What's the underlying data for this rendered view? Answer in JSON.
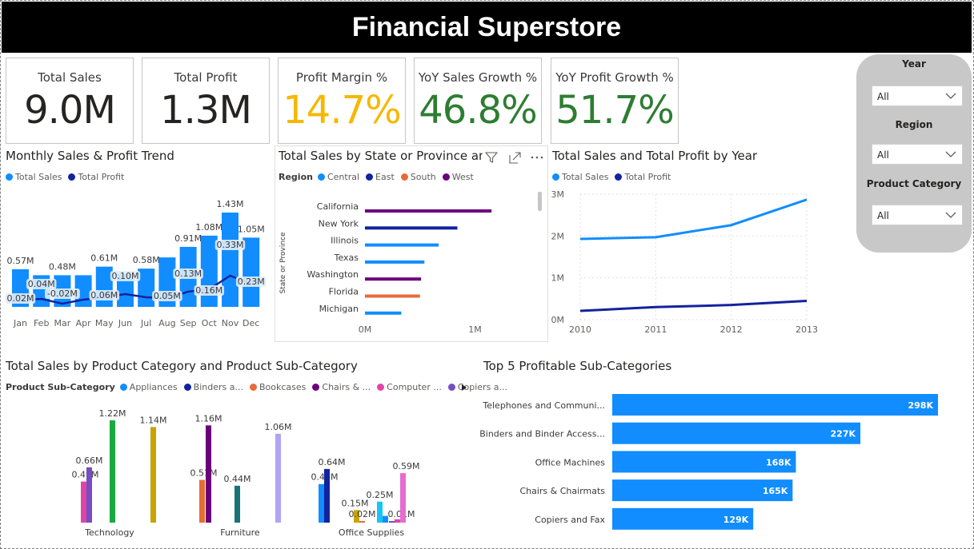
{
  "header": {
    "title": "Financial Superstore"
  },
  "kpis": [
    {
      "label": "Total Sales",
      "value": "9.0M",
      "color": "#252423"
    },
    {
      "label": "Total Profit",
      "value": "1.3M",
      "color": "#252423"
    },
    {
      "label": "Profit Margin %",
      "value": "14.7%",
      "color": "#F5B800"
    },
    {
      "label": "YoY Sales Growth %",
      "value": "46.8%",
      "color": "#2E7D32"
    },
    {
      "label": "YoY Profit Growth %",
      "value": "51.7%",
      "color": "#2E7D32"
    }
  ],
  "slicers": [
    {
      "title": "Year",
      "value": "All"
    },
    {
      "title": "Region",
      "value": "All"
    },
    {
      "title": "Product Category",
      "value": "All"
    }
  ],
  "colors": {
    "sales": "#118DFF",
    "profit": "#12239E",
    "central": "#118DFF",
    "east": "#12239E",
    "south": "#E66C37",
    "west": "#6B007B"
  },
  "chart_data": [
    {
      "id": "monthly",
      "type": "bar",
      "title": "Monthly Sales & Profit Trend",
      "legend": [
        "Total Sales",
        "Total Profit"
      ],
      "categories": [
        "Jan",
        "Feb",
        "Mar",
        "Apr",
        "May",
        "Jun",
        "Jul",
        "Aug",
        "Sep",
        "Oct",
        "Nov",
        "Dec"
      ],
      "series": [
        {
          "name": "Total Sales",
          "type": "bar",
          "values": [
            0.57,
            0.48,
            0.48,
            0.48,
            0.61,
            0.5,
            0.58,
            0.75,
            0.91,
            1.08,
            1.43,
            1.05
          ],
          "labels": [
            "0.57M",
            "",
            "0.48M",
            "",
            "0.61M",
            "",
            "0.58M",
            "",
            "0.91M",
            "1.08M",
            "1.43M",
            "1.05M"
          ]
        },
        {
          "name": "Total Profit",
          "type": "line",
          "values": [
            0.02,
            0.04,
            -0.02,
            0.03,
            0.06,
            0.1,
            0.06,
            0.05,
            0.13,
            0.16,
            0.33,
            0.23
          ],
          "labels": [
            "0.02M",
            "0.04M",
            "-0.02M",
            "",
            "0.06M",
            "0.10M",
            "",
            "0.05M",
            "0.13M",
            "0.16M",
            "0.33M",
            "0.23M"
          ]
        }
      ]
    },
    {
      "id": "state",
      "type": "bar",
      "title": "Total Sales by State or Province and",
      "legend_title": "Region",
      "legend": [
        "Central",
        "East",
        "South",
        "West"
      ],
      "ylabel": "State or Province",
      "categories": [
        "California",
        "New York",
        "Illinois",
        "Texas",
        "Washington",
        "Florida",
        "Michigan"
      ],
      "values": [
        1.15,
        0.84,
        0.67,
        0.54,
        0.51,
        0.5,
        0.33
      ],
      "regions": [
        "West",
        "East",
        "Central",
        "Central",
        "West",
        "South",
        "Central"
      ],
      "xticks": [
        "0M",
        "1M"
      ],
      "xlim": [
        0,
        1.6
      ]
    },
    {
      "id": "yearly",
      "type": "line",
      "title": "Total Sales and Total Profit by Year",
      "legend": [
        "Total Sales",
        "Total Profit"
      ],
      "x": [
        "2010",
        "2011",
        "2012",
        "2013"
      ],
      "series": [
        {
          "name": "Total Sales",
          "values": [
            1.93,
            1.97,
            2.26,
            2.87
          ]
        },
        {
          "name": "Total Profit",
          "values": [
            0.21,
            0.3,
            0.35,
            0.45
          ]
        }
      ],
      "yticks": [
        "0M",
        "1M",
        "2M",
        "3M"
      ],
      "ylim": [
        0,
        3
      ]
    },
    {
      "id": "category",
      "type": "bar",
      "title": "Total Sales by Product Category and Product Sub-Category",
      "legend_title": "Product Sub-Category",
      "legend": [
        "Appliances",
        "Binders a...",
        "Bookcases",
        "Chairs & ...",
        "Computer ...",
        "Copiers a..."
      ],
      "categories": [
        "Technology",
        "Furniture",
        "Office Supplies"
      ],
      "groups": [
        {
          "category": "Technology",
          "bars": [
            {
              "value": 0.49,
              "label": "0.49M",
              "color": "#E044A7"
            },
            {
              "value": 0.66,
              "label": "0.66M",
              "color": "#744EC2"
            },
            {
              "value": 1.22,
              "label": "1.22M",
              "color": "#1AAB40"
            },
            {
              "value": 1.14,
              "label": "1.14M",
              "color": "#C8A400"
            }
          ]
        },
        {
          "category": "Furniture",
          "bars": [
            {
              "value": 0.51,
              "label": "0.51M",
              "color": "#E66C37"
            },
            {
              "value": 1.16,
              "label": "1.16M",
              "color": "#6B007B"
            },
            {
              "value": 0.44,
              "label": "0.44M",
              "color": "#197278"
            },
            {
              "value": 1.06,
              "label": "1.06M",
              "color": "#B0A4F5"
            }
          ]
        },
        {
          "category": "Office Supplies",
          "bars": [
            {
              "value": 0.46,
              "label": "0.46M",
              "color": "#118DFF"
            },
            {
              "value": 0.64,
              "label": "0.64M",
              "color": "#12239E"
            },
            {
              "value": 0.15,
              "label": "0.15M",
              "color": "#C8A400"
            },
            {
              "value": 0.02,
              "label": "0.02M",
              "color": "#E66C37"
            },
            {
              "value": 0.25,
              "label": "0.25M",
              "color": "#15C6F4"
            },
            {
              "value": 0.08,
              "label": "",
              "color": "#118DFF"
            },
            {
              "value": 0.01,
              "label": "0.01M",
              "color": "#744EC2"
            },
            {
              "value": 0.04,
              "label": "",
              "color": "#E044A7"
            },
            {
              "value": 0.59,
              "label": "0.59M",
              "color": "#E66CD2"
            }
          ]
        }
      ],
      "ylim": [
        0,
        1.3
      ]
    },
    {
      "id": "top5",
      "type": "bar",
      "title": "Top 5 Profitable Sub-Categories",
      "categories": [
        "Telephones and Communi...",
        "Binders and Binder Access...",
        "Office Machines",
        "Chairs & Chairmats",
        "Copiers and Fax"
      ],
      "values": [
        298,
        227,
        168,
        165,
        129
      ],
      "labels": [
        "298K",
        "227K",
        "168K",
        "165K",
        "129K"
      ],
      "xlim": [
        0,
        320
      ]
    }
  ]
}
